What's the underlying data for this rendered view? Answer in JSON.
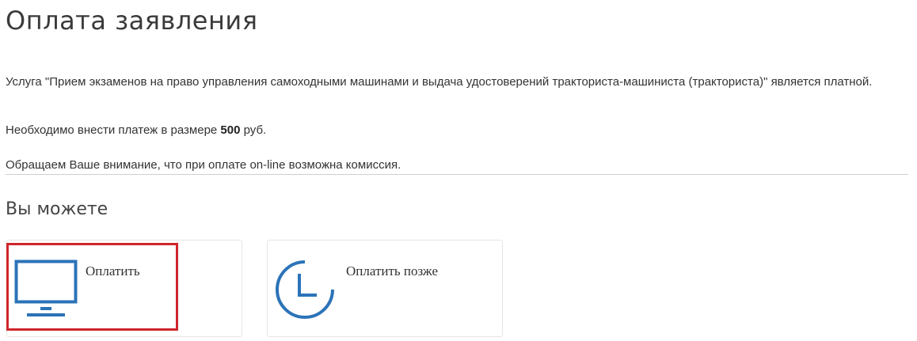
{
  "page": {
    "title": "Оплата заявления"
  },
  "info": {
    "service_text": "Услуга \"Прием экзаменов на право управления самоходными машинами и выдача удостоверений тракториста-машиниста (тракториста)\" является платной.",
    "payment_prefix": "Необходимо внести платеж в размере ",
    "payment_amount": "500",
    "payment_suffix": " руб.",
    "commission_note": "Обращаем Ваше внимание, что при оплате on-line возможна комиссия."
  },
  "options": {
    "heading": "Вы можете",
    "pay_label": "Оплатить",
    "pay_icon": "monitor-icon",
    "later_label": "Оплатить позже",
    "later_icon": "clock-icon"
  },
  "colors": {
    "accent": "#2b73b8",
    "highlight": "#d0252b"
  }
}
